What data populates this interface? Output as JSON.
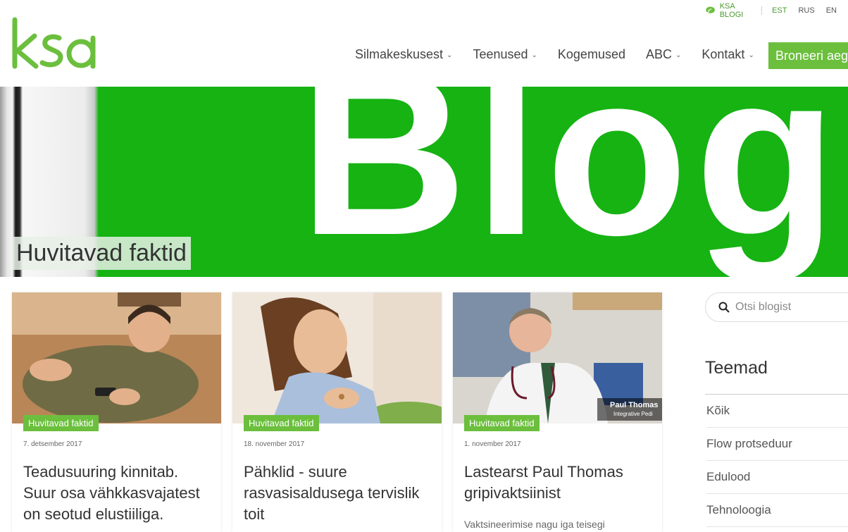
{
  "topbar": {
    "blog_label": "KSA BLOGI",
    "languages": [
      "EST",
      "RUS",
      "EN"
    ]
  },
  "logo": {
    "text": "ksa"
  },
  "nav": {
    "items": [
      "Silmakeskusest",
      "Teenused",
      "Kogemused",
      "ABC",
      "Kontakt"
    ],
    "cta": "Broneeri aeg"
  },
  "hero": {
    "word": "Blog",
    "caption": "Huvitavad faktid"
  },
  "cards": [
    {
      "tag": "Huvitavad faktid",
      "date": "7. detsember 2017",
      "title": "Teadusuuring kinnitab. Suur osa vähkkasvajatest on seotud elustiiliga.",
      "excerpt": ""
    },
    {
      "tag": "Huvitavad faktid",
      "date": "18. november 2017",
      "title": "Pähklid - suure rasvasisaldusega tervislik toit",
      "excerpt": ""
    },
    {
      "tag": "Huvitavad faktid",
      "date": "1. november 2017",
      "title": "Lastearst Paul Thomas gripivaktsiinist",
      "excerpt": "Vaktsineerimise nagu iga teisegi",
      "video_caption": "Paul Thomas",
      "video_subcaption": "Integrative Pedi"
    }
  ],
  "sidebar": {
    "search_placeholder": "Otsi blogist",
    "topics_title": "Teemad",
    "topics": [
      "Kõik",
      "Flow protseduur",
      "Edulood",
      "Tehnoloogia"
    ]
  },
  "colors": {
    "brand_green": "#6bbf3d",
    "hero_green": "#16b313"
  }
}
